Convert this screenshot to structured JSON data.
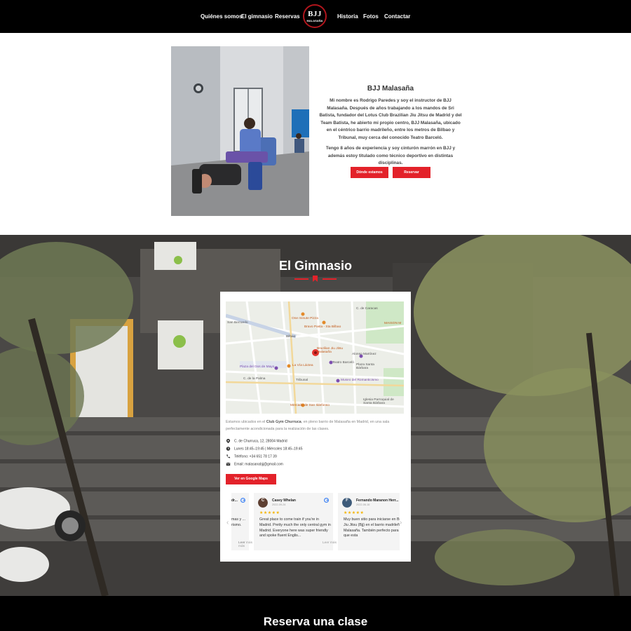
{
  "nav": {
    "items": [
      "Quiénes somos",
      "El gimnasio",
      "Reservas",
      "Historia",
      "Fotos",
      "Contactar"
    ],
    "logo_text": "BJJ",
    "logo_sub": "MALASAÑA"
  },
  "about": {
    "title": "BJJ Malasaña",
    "p1": "Mi nombre es Rodrigo Paredes y soy el instructor de BJJ Malasaña. Después de años trabajando a los mandos de Sri Batista, fundador del Lotus Club Brazilian Jiu Jitsu de Madrid y del Team Batista, he abierto mi propio centro, BJJ Malasaña, ubicado en el céntrico barrio madrileño, entre los metros de Bilbao y Tribunal, muy cerca del conocido Teatro Barceló.",
    "p2": "Tengo 8 años de experiencia y soy cinturón marrón en BJJ y además estoy titulado como técnico deportivo en distintas disciplinas.",
    "btn_location": "Dónde estamos",
    "btn_reserve": "Reservar"
  },
  "gym": {
    "title": "El Gimnasio",
    "map_labels": {
      "caracas": "C. de Caracas",
      "bernardo": "San Bernardo",
      "one_minute": "One minute Pizza",
      "bravo": "Bravo Pasta - Sta Bilbao",
      "bilbao": "Bilbao",
      "brazilian": "Brazilian Jiu Jitsu Malasaña",
      "alonso": "Alonso Martínez",
      "barcelo": "Teatro Barceló",
      "santa_barbara": "Plaza Santa Bárbara",
      "dos_mayo": "Plaza del Dos de Mayo",
      "la_vaca": "La Vía Láctea",
      "tribunal": "Tribunal",
      "romanticismo": "Museo del Romanticismo",
      "palma": "C. de la Palma",
      "mercado": "Mercado de San Ildefonso",
      "iglesia": "Iglesia Parroquial de Santa Bárbara",
      "maison": "MAISON M"
    },
    "desc_pre": "Estamos ubicados en el ",
    "desc_bold": "Club Gym Churruca",
    "desc_post": ", en pleno barrio de Malasaña en Madrid, en una sala perfectamente acondicionada para la realización de las clases.",
    "address": "C. de Churruca, 12, 28004 Madrid",
    "hours": "Lunes 18:45–19:45 | Miércoles 18:45–19:45",
    "phone": "Teléfono: +34 651 78 17 39",
    "email": "Email: malasanabjj@gmail.com",
    "btn_maps": "Ver en Google Maps",
    "reviews": [
      {
        "name": "Casey Whelan",
        "initial": "C",
        "date": "2022-09-24",
        "stars": "★★★★★",
        "text": "Great place to come train if you're in Madrid. Pretty much the only central gym in Madrid. Everyone here was super friendly and spoke fluent Englis...",
        "more": "Leer más"
      },
      {
        "name": "Fernando Maranon Herr...",
        "initial": "F",
        "date": "2022-06-16",
        "stars": "★★★★★",
        "text": "Muy buen sitio para iniciarse en Brazilian Jiu Jitsu (Bjj) en el barrio madrileño de Malasaña. También perfecto para la gente que esta",
        "more": "Leer más"
      }
    ],
    "partial_review": {
      "name": "dr...",
      "text": "mas y ... rismo.",
      "more": "Leer más"
    }
  },
  "reserva": {
    "title": "Reserva una clase"
  },
  "colors": {
    "accent": "#e3222a",
    "nav_bg": "#000000"
  }
}
